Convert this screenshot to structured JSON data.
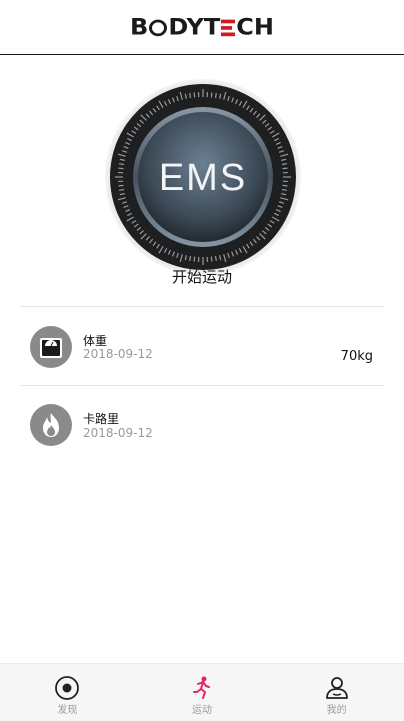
{
  "header": {
    "brand": "BODYTECH"
  },
  "ems": {
    "label": "EMS",
    "start_label": "开始运动"
  },
  "records": [
    {
      "title": "体重",
      "date": "2018-09-12",
      "value": "70kg",
      "icon": "scale-icon"
    },
    {
      "title": "卡路里",
      "date": "2018-09-12",
      "value": "",
      "icon": "flame-icon"
    }
  ],
  "tabbar": {
    "tabs": [
      {
        "label": "发现",
        "icon": "discover-icon",
        "active": false
      },
      {
        "label": "运动",
        "icon": "running-icon",
        "active": true
      },
      {
        "label": "我的",
        "icon": "profile-icon",
        "active": false
      }
    ]
  },
  "colors": {
    "brand_red": "#d21a20",
    "active_tab": "#e2256b"
  }
}
